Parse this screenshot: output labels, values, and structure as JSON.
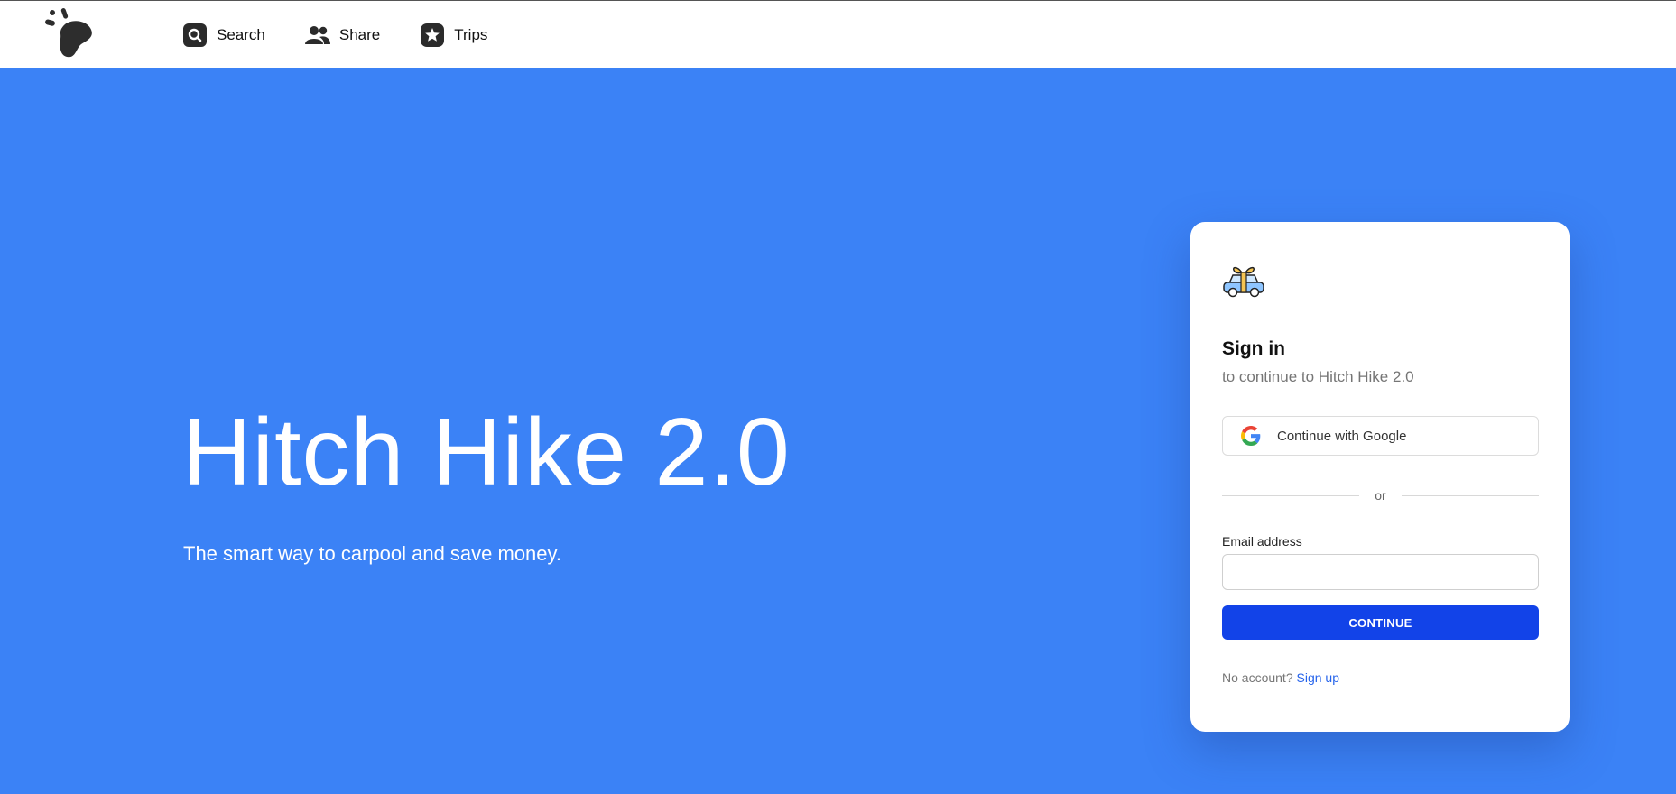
{
  "nav": {
    "items": [
      {
        "label": "Search",
        "icon": "search-icon"
      },
      {
        "label": "Share",
        "icon": "users-icon"
      },
      {
        "label": "Trips",
        "icon": "star-icon"
      }
    ]
  },
  "hero": {
    "title": "Hitch Hike 2.0",
    "subtitle": "The smart way to carpool and save money."
  },
  "signin": {
    "title": "Sign in",
    "subtitle": "to continue to Hitch Hike 2.0",
    "google_label": "Continue with Google",
    "divider": "or",
    "email_label": "Email address",
    "email_value": "",
    "continue_label": "CONTINUE",
    "no_account": "No account?",
    "signup_label": "Sign up"
  },
  "colors": {
    "background": "#3b82f6",
    "primary_button": "#1243e8",
    "link": "#2563eb"
  }
}
